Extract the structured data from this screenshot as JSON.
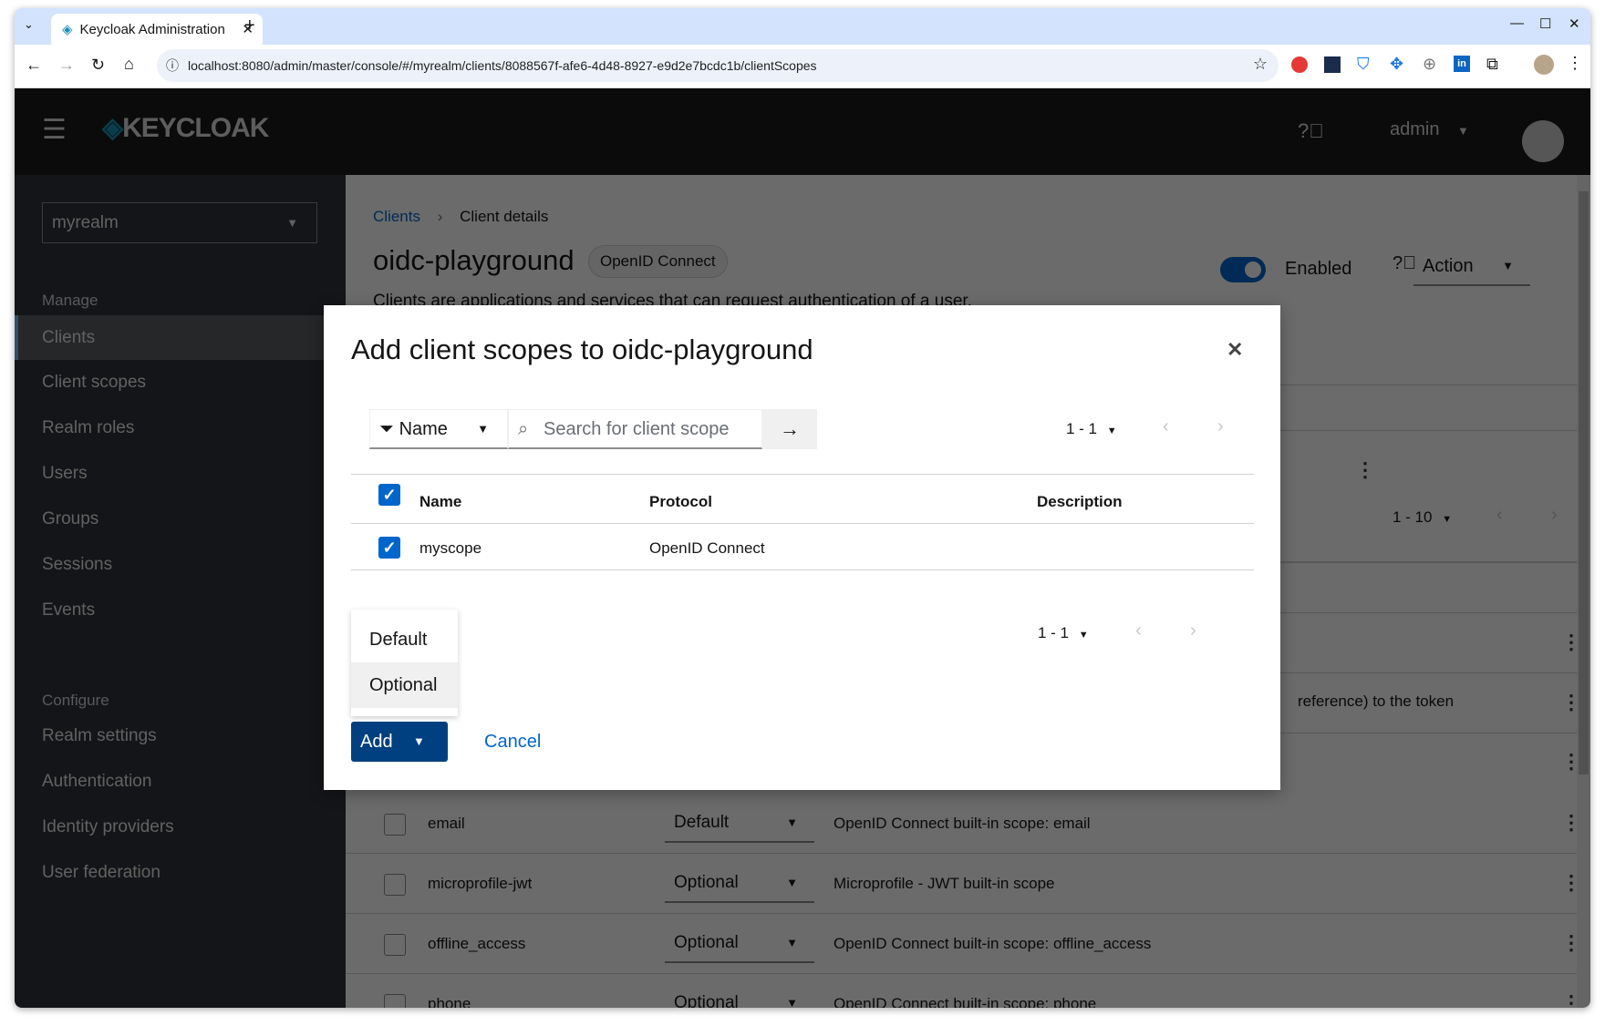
{
  "browser": {
    "tab_title": "Keycloak Administration",
    "url": "localhost:8080/admin/master/console/#/myrealm/clients/8088567f-afe6-4d48-8927-e9d2e7bcdc1b/clientScopes",
    "new_tab": "+"
  },
  "header": {
    "logo": "KEYCLOAK",
    "user": "admin"
  },
  "sidebar": {
    "realm": "myrealm",
    "manage_label": "Manage",
    "configure_label": "Configure",
    "manage_items": [
      {
        "label": "Clients",
        "active": true
      },
      {
        "label": "Client scopes"
      },
      {
        "label": "Realm roles"
      },
      {
        "label": "Users"
      },
      {
        "label": "Groups"
      },
      {
        "label": "Sessions"
      },
      {
        "label": "Events"
      }
    ],
    "configure_items": [
      {
        "label": "Realm settings"
      },
      {
        "label": "Authentication"
      },
      {
        "label": "Identity providers"
      },
      {
        "label": "User federation"
      }
    ]
  },
  "page": {
    "breadcrumb": [
      "Clients",
      "Client details"
    ],
    "title": "oidc-playground",
    "protocol_badge": "OpenID Connect",
    "description": "Clients are applications and services that can request authentication of a user.",
    "enabled_label": "Enabled",
    "enabled": true,
    "action_label": "Action",
    "pagination": "1 - 10",
    "partial_text": "reference) to the token",
    "rows": [
      {
        "name": "email",
        "type": "Default",
        "description": "OpenID Connect built-in scope: email"
      },
      {
        "name": "microprofile-jwt",
        "type": "Optional",
        "description": "Microprofile - JWT built-in scope"
      },
      {
        "name": "offline_access",
        "type": "Optional",
        "description": "OpenID Connect built-in scope: offline_access"
      },
      {
        "name": "phone",
        "type": "Optional",
        "description": "OpenID Connect built-in scope: phone"
      }
    ]
  },
  "modal": {
    "title": "Add client scopes to oidc-playground",
    "filter_label": "Name",
    "search_placeholder": "Search for client scope",
    "pagination": "1 - 1",
    "columns": [
      "Name",
      "Protocol",
      "Description"
    ],
    "rows": [
      {
        "name": "myscope",
        "protocol": "OpenID Connect",
        "description": "",
        "checked": true
      }
    ],
    "dropdown_options": [
      "Default",
      "Optional"
    ],
    "add_label": "Add",
    "cancel_label": "Cancel"
  },
  "colors": {
    "primary": "#0066cc",
    "add_button": "#004080",
    "toggle": "#0066cc"
  }
}
